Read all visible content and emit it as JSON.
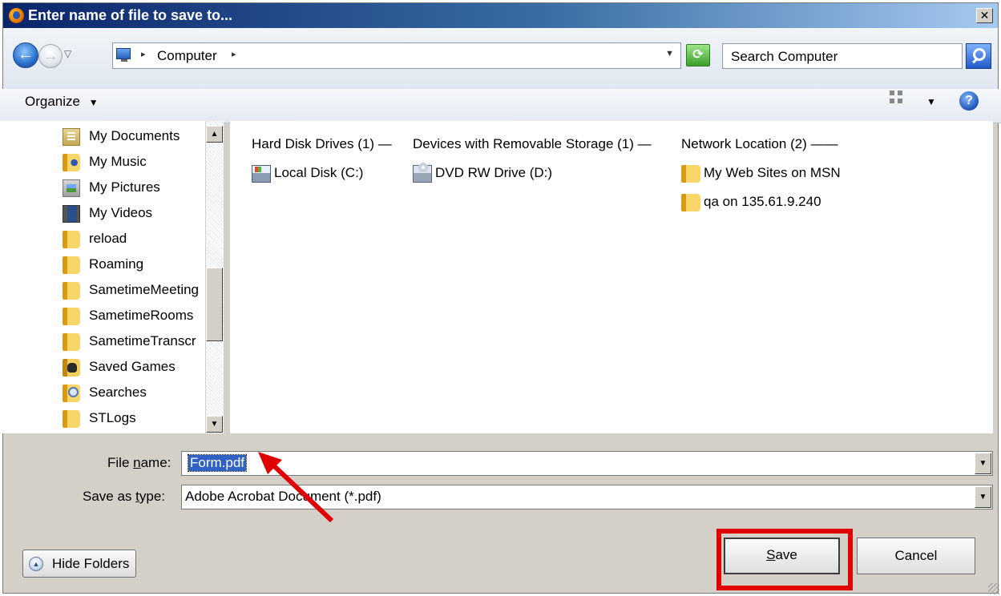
{
  "window": {
    "title": "Enter name of file to save to...",
    "close_glyph": "✕",
    "title_icon": "firefox-icon"
  },
  "nav": {
    "back_glyph": "←",
    "forward_glyph": "→",
    "recent_glyph": "▽",
    "address": "Computer",
    "address_sep": "▸",
    "address_drop": "▼",
    "refresh_glyph": "⟳",
    "search_placeholder": "Search Computer"
  },
  "toolbar": {
    "organize_label": "Organize",
    "organize_drop": "▼",
    "views_drop": "▼",
    "help_glyph": "?"
  },
  "tree": {
    "items": [
      {
        "label": "My Documents",
        "icon": "documents-icon"
      },
      {
        "label": "My Music",
        "icon": "music-folder-icon"
      },
      {
        "label": "My Pictures",
        "icon": "pictures-icon"
      },
      {
        "label": "My Videos",
        "icon": "videos-icon"
      },
      {
        "label": "reload",
        "icon": "folder-icon"
      },
      {
        "label": "Roaming",
        "icon": "folder-icon"
      },
      {
        "label": "SametimeMeeting",
        "icon": "folder-icon"
      },
      {
        "label": "SametimeRooms",
        "icon": "folder-icon"
      },
      {
        "label": "SametimeTranscr",
        "icon": "folder-icon"
      },
      {
        "label": "Saved Games",
        "icon": "saved-games-icon"
      },
      {
        "label": "Searches",
        "icon": "searches-icon"
      },
      {
        "label": "STLogs",
        "icon": "folder-icon"
      }
    ],
    "scroll_up": "▲",
    "scroll_down": "▼"
  },
  "content": {
    "groups": [
      {
        "header": "Hard Disk Drives (1) —",
        "items": [
          {
            "label": "Local Disk (C:)",
            "icon": "local-disk-icon"
          }
        ]
      },
      {
        "header": "Devices with Removable Storage (1) —",
        "items": [
          {
            "label": "DVD RW Drive (D:)",
            "icon": "dvd-drive-icon"
          }
        ]
      },
      {
        "header": "Network Location (2) ——",
        "items": [
          {
            "label": "My Web Sites on MSN",
            "icon": "network-folder-icon"
          },
          {
            "label": "qa on 135.61.9.240",
            "icon": "network-folder-icon"
          }
        ]
      }
    ]
  },
  "form": {
    "file_name_label_pre": "File ",
    "file_name_label_u": "n",
    "file_name_label_post": "ame:",
    "file_name_value": "Form.pdf",
    "save_type_label_pre": "Save as ",
    "save_type_label_u": "t",
    "save_type_label_post": "ype:",
    "save_type_value": "Adobe Acrobat Document (*.pdf)",
    "combo_drop": "▼"
  },
  "buttons": {
    "hide_folders": "Hide Folders",
    "hide_glyph": "▲",
    "save_u": "S",
    "save_rest": "ave",
    "cancel": "Cancel"
  },
  "annotations": {
    "arrow_color": "#e00000",
    "highlight_color": "#e00000"
  }
}
